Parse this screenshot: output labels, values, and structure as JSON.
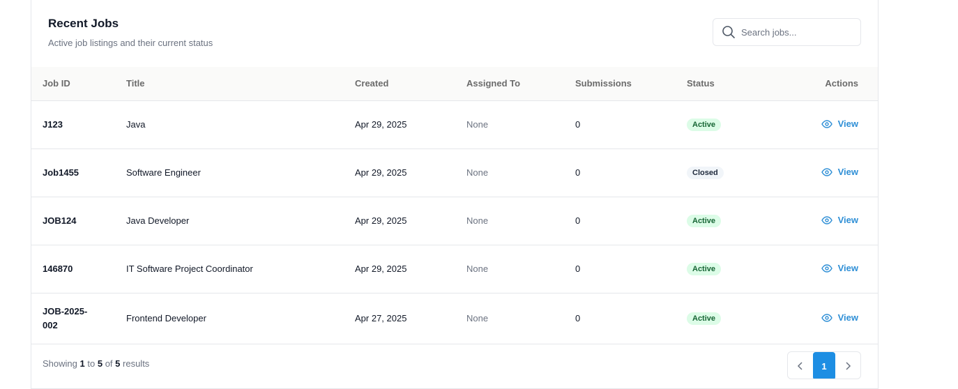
{
  "header": {
    "title": "Recent Jobs",
    "subtitle": "Active job listings and their current status"
  },
  "search": {
    "placeholder": "Search jobs...",
    "icon": "search-icon"
  },
  "table": {
    "columns": [
      "Job ID",
      "Title",
      "Created",
      "Assigned To",
      "Submissions",
      "Status",
      "Actions"
    ],
    "rows": [
      {
        "id": "J123",
        "title": "Java",
        "created": "Apr 29, 2025",
        "assigned": "None",
        "submissions": "0",
        "status": "Active",
        "action": "View"
      },
      {
        "id": "Job1455",
        "title": "Software Engineer",
        "created": "Apr 29, 2025",
        "assigned": "None",
        "submissions": "0",
        "status": "Closed",
        "action": "View"
      },
      {
        "id": "JOB124",
        "title": "Java Developer",
        "created": "Apr 29, 2025",
        "assigned": "None",
        "submissions": "0",
        "status": "Active",
        "action": "View"
      },
      {
        "id": "146870",
        "title": "IT Software Project Coordinator",
        "created": "Apr 29, 2025",
        "assigned": "None",
        "submissions": "0",
        "status": "Active",
        "action": "View"
      },
      {
        "id": "JOB-2025-002",
        "title": "Frontend Developer",
        "created": "Apr 27, 2025",
        "assigned": "None",
        "submissions": "0",
        "status": "Active",
        "action": "View"
      }
    ]
  },
  "footer": {
    "showing_prefix": "Showing",
    "from": "1",
    "to_word": "to",
    "to": "5",
    "of_word": "of",
    "total": "5",
    "suffix": "results"
  },
  "pagination": {
    "prev": "‹",
    "current": "1",
    "next": "›"
  },
  "colors": {
    "accent": "#1d8ee3",
    "link": "#2f8fd6",
    "active_bg": "#dcfce7",
    "active_text": "#166534",
    "closed_bg": "#f1f5f9"
  }
}
